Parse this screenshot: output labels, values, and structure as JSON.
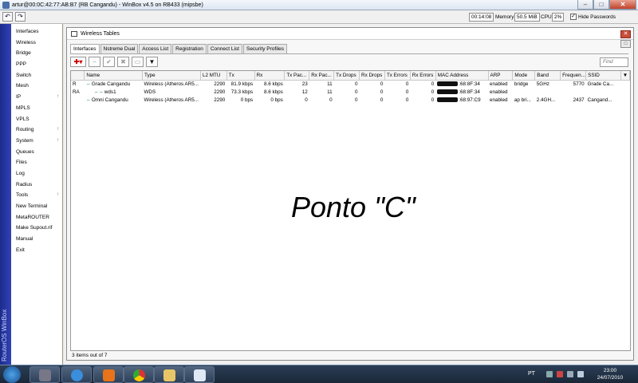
{
  "window": {
    "title": "artur@00:0C:42:77:AB:B7 (RB Cangandu) - WinBox v4.5 on RB433 (mipsbe)",
    "min_label": "–",
    "max_label": "□",
    "close_label": "✕"
  },
  "toolbar": {
    "undo_label": "↶",
    "redo_label": "↷",
    "uptime": "00:14:08",
    "memory_label": "Memory:",
    "memory": "50.5 MiB",
    "cpu_label": "CPU:",
    "cpu": "2%",
    "hide_passwords_label": "Hide Passwords",
    "hide_passwords_checked": "✓"
  },
  "sidebar": {
    "brand": "RouterOS WinBox",
    "items": [
      {
        "label": "Interfaces",
        "arrow": ""
      },
      {
        "label": "Wireless",
        "arrow": ""
      },
      {
        "label": "Bridge",
        "arrow": ""
      },
      {
        "label": "PPP",
        "arrow": ""
      },
      {
        "label": "Switch",
        "arrow": ""
      },
      {
        "label": "Mesh",
        "arrow": ""
      },
      {
        "label": "IP",
        "arrow": "↑"
      },
      {
        "label": "MPLS",
        "arrow": ""
      },
      {
        "label": "VPLS",
        "arrow": ""
      },
      {
        "label": "Routing",
        "arrow": "↑"
      },
      {
        "label": "System",
        "arrow": "↑"
      },
      {
        "label": "Queues",
        "arrow": ""
      },
      {
        "label": "Files",
        "arrow": ""
      },
      {
        "label": "Log",
        "arrow": ""
      },
      {
        "label": "Radius",
        "arrow": ""
      },
      {
        "label": "Tools",
        "arrow": "↑"
      },
      {
        "label": "New Terminal",
        "arrow": ""
      },
      {
        "label": "MetaROUTER",
        "arrow": ""
      },
      {
        "label": "Make Supout.rif",
        "arrow": ""
      },
      {
        "label": "Manual",
        "arrow": ""
      },
      {
        "label": "Exit",
        "arrow": ""
      }
    ]
  },
  "wireless": {
    "title": "Wireless Tables",
    "tabs": [
      "Interfaces",
      "Nstreme Dual",
      "Access List",
      "Registration",
      "Connect List",
      "Security Profiles"
    ],
    "find_placeholder": "Find",
    "columns": [
      "",
      "Name",
      "Type",
      "L2 MTU",
      "Tx",
      "Rx",
      "Tx Pac...",
      "Rx Pac...",
      "Tx Drops",
      "Rx Drops",
      "Tx Errors",
      "Rx Errors",
      "MAC Address",
      "ARP",
      "Mode",
      "Band",
      "Frequen...",
      "SSID"
    ],
    "rows": [
      {
        "flag": "R",
        "name": "Grade Cangandu",
        "icon": "⇔",
        "indent": false,
        "type": "Wireless (Atheros AR5...",
        "l2mtu": "2290",
        "tx": "81.9 kbps",
        "rx": "8.6 kbps",
        "txp": "23",
        "rxp": "11",
        "txd": "0",
        "rxd": "0",
        "txe": "0",
        "rxe": "0",
        "mac": ":68:8F:34",
        "arp": "enabled",
        "mode": "bridge",
        "band": "5GHz",
        "freq": "5770",
        "ssid": "Grade Ca..."
      },
      {
        "flag": "RA",
        "name": "wds1",
        "icon": "⇔⇔",
        "indent": true,
        "type": "WDS",
        "l2mtu": "2290",
        "tx": "73.3 kbps",
        "rx": "8.6 kbps",
        "txp": "12",
        "rxp": "11",
        "txd": "0",
        "rxd": "0",
        "txe": "0",
        "rxe": "0",
        "mac": ":68:8F:34",
        "arp": "enabled",
        "mode": "",
        "band": "",
        "freq": "",
        "ssid": ""
      },
      {
        "flag": "",
        "name": "Omni Cangandu",
        "icon": "⇔",
        "indent": false,
        "type": "Wireless (Atheros AR5...",
        "l2mtu": "2290",
        "tx": "0 bps",
        "rx": "0 bps",
        "txp": "0",
        "rxp": "0",
        "txd": "0",
        "rxd": "0",
        "txe": "0",
        "rxe": "0",
        "mac": ":68:97:C9",
        "arp": "enabled",
        "mode": "ap bri...",
        "band": "2.4GH...",
        "freq": "2437",
        "ssid": "Cangand..."
      }
    ],
    "status": "3 items out of 7",
    "overlay": "Ponto \"C\""
  },
  "taskbar": {
    "lang": "PT",
    "time": "23:00",
    "date": "24/07/2010"
  }
}
